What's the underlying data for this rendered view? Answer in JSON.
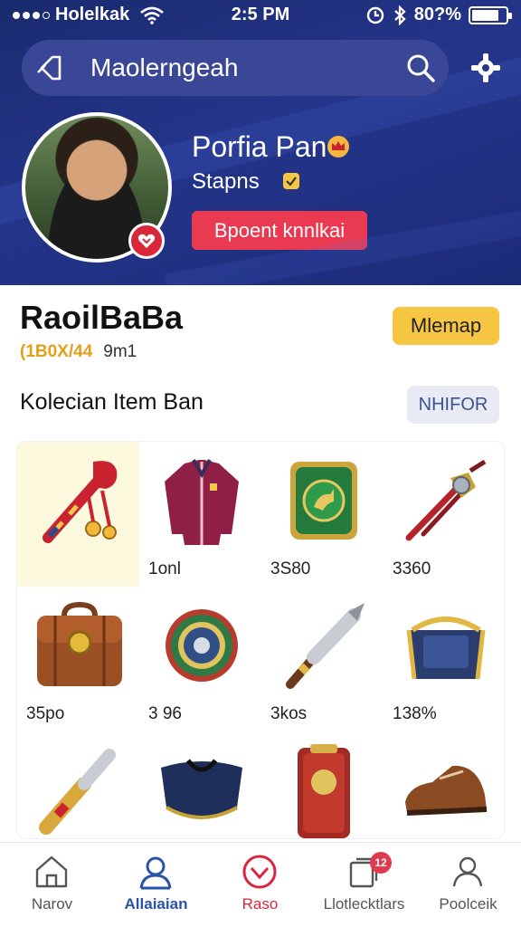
{
  "status_bar": {
    "carrier": "Holelkak",
    "time": "2:5 PM",
    "battery": "80?%",
    "battery_level": 0.8
  },
  "search": {
    "text": "Maolerngeah"
  },
  "profile": {
    "name": "Porfia Pan",
    "status": "Stapns",
    "button_label": "Bpoent knnlkai"
  },
  "shop": {
    "title": "RaoilBaBa",
    "coins": "(1B0X/44",
    "distance": "9m1",
    "action_label": "Mlemap"
  },
  "section": {
    "title": "Kolecian Item Ban",
    "button_label": "NHIFOR"
  },
  "items": [
    {
      "icon": "scarf-medal-icon",
      "price": ""
    },
    {
      "icon": "jacket-icon",
      "price": "1onl"
    },
    {
      "icon": "card-icon",
      "price": "3S80"
    },
    {
      "icon": "blade-icon",
      "price": "3360"
    },
    {
      "icon": "briefcase-icon",
      "price": "35po"
    },
    {
      "icon": "shield-icon",
      "price": "3 96"
    },
    {
      "icon": "torch-icon",
      "price": "3kos"
    },
    {
      "icon": "bag-icon",
      "price": "138%"
    },
    {
      "icon": "flashlight-icon",
      "price": ""
    },
    {
      "icon": "collar-icon",
      "price": ""
    },
    {
      "icon": "cabinet-icon",
      "price": ""
    },
    {
      "icon": "shoe-icon",
      "price": ""
    }
  ],
  "nav": [
    {
      "label": "Narov",
      "icon": "home-icon"
    },
    {
      "label": "Allaiaian",
      "icon": "profile-icon"
    },
    {
      "label": "Raso",
      "icon": "heart-icon"
    },
    {
      "label": "Llotlecktlars",
      "icon": "collection-icon",
      "badge": "12"
    },
    {
      "label": "Poolceik",
      "icon": "user-icon"
    }
  ],
  "colors": {
    "header": "#24358a",
    "accent_red": "#e93a52",
    "accent_yellow": "#f6c542",
    "nav_active": "#2a52a8"
  }
}
